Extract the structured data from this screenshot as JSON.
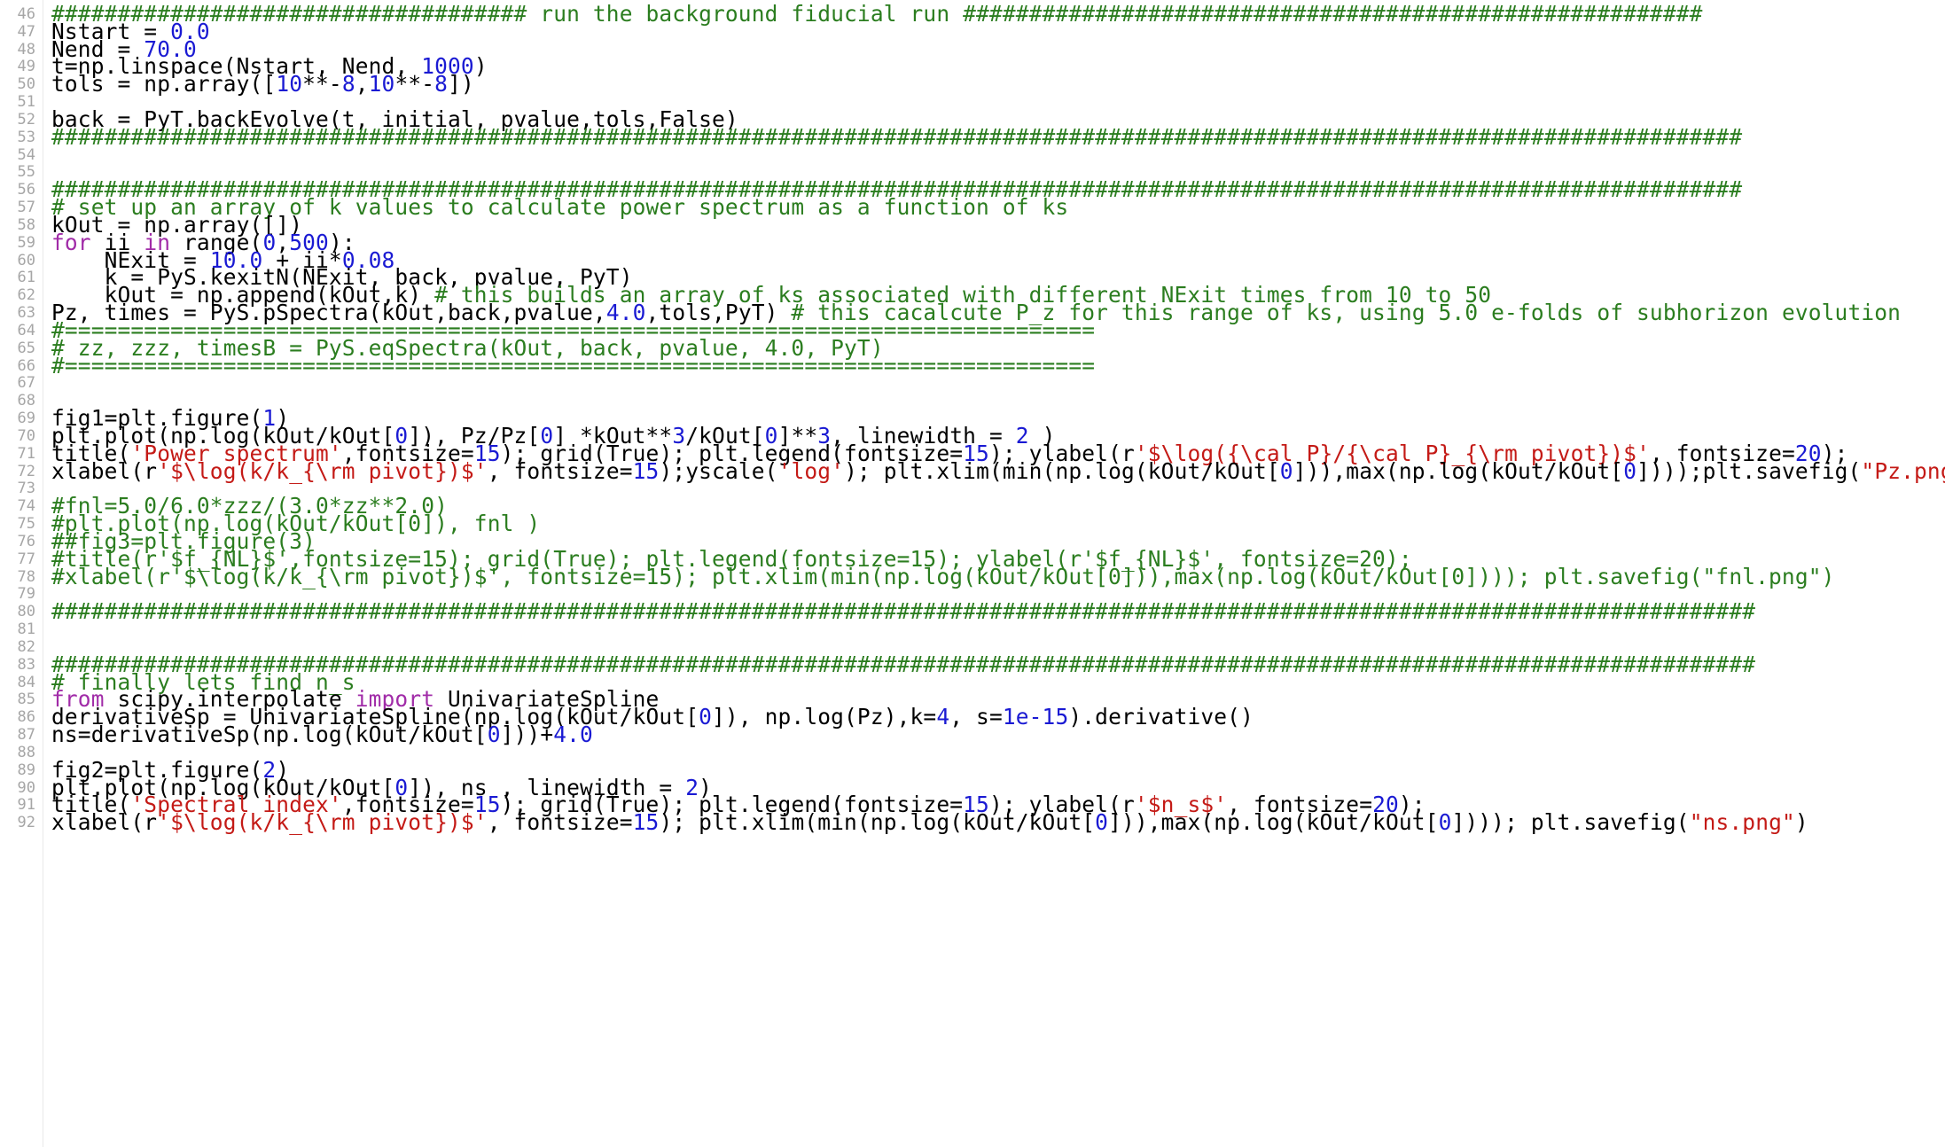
{
  "editor": {
    "colors": {
      "comment": "#2b7d1f",
      "keyword": "#a12ca8",
      "number": "#1a1ad3",
      "string": "#c41a16",
      "line_number": "#a6a6a6",
      "text": "#000000"
    },
    "lines": [
      {
        "n": "46",
        "t": "#################################### run the background fiducial run ########################################################"
      },
      {
        "n": "47",
        "t": "Nstart = 0.0"
      },
      {
        "n": "48",
        "t": "Nend = 70.0"
      },
      {
        "n": "49",
        "t": "t=np.linspace(Nstart, Nend, 1000)"
      },
      {
        "n": "50",
        "t": "tols = np.array([10**-8,10**-8])"
      },
      {
        "n": "51",
        "t": ""
      },
      {
        "n": "52",
        "t": "back = PyT.backEvolve(t, initial, pvalue,tols,False)"
      },
      {
        "n": "53",
        "t": "################################################################################################################################"
      },
      {
        "n": "54",
        "t": ""
      },
      {
        "n": "55",
        "t": ""
      },
      {
        "n": "56",
        "t": "################################################################################################################################"
      },
      {
        "n": "57",
        "t": "# set up an array of k values to calculate power spectrum as a function of ks"
      },
      {
        "n": "58",
        "t": "kOut = np.array([])"
      },
      {
        "n": "59",
        "t": "for ii in range(0,500):"
      },
      {
        "n": "60",
        "t": "    NExit = 10.0 + ii*0.08"
      },
      {
        "n": "61",
        "t": "    k = PyS.kexitN(NExit, back, pvalue, PyT)"
      },
      {
        "n": "62",
        "t": "    kOut = np.append(kOut,k) # this builds an array of ks associated with different NExit times from 10 to 50"
      },
      {
        "n": "63",
        "t": "Pz, times = PyS.pSpectra(kOut,back,pvalue,4.0,tols,PyT) # this cacalcute P_z for this range of ks, using 5.0 e-folds of subhorizon evolution"
      },
      {
        "n": "64",
        "t": "#=============================================================================="
      },
      {
        "n": "65",
        "t": "# zz, zzz, timesB = PyS.eqSpectra(kOut, back, pvalue, 4.0, PyT)"
      },
      {
        "n": "66",
        "t": "#=============================================================================="
      },
      {
        "n": "67",
        "t": ""
      },
      {
        "n": "68",
        "t": ""
      },
      {
        "n": "69",
        "t": "fig1=plt.figure(1)"
      },
      {
        "n": "70",
        "t": "plt.plot(np.log(kOut/kOut[0]), Pz/Pz[0] *kOut**3/kOut[0]**3, linewidth = 2 )"
      },
      {
        "n": "71",
        "t": "title('Power spectrum',fontsize=15); grid(True); plt.legend(fontsize=15); ylabel(r'$\\log({\\cal P}/{\\cal P}_{\\rm pivot})$', fontsize=20);"
      },
      {
        "n": "72",
        "t": "xlabel(r'$\\log(k/k_{\\rm pivot})$', fontsize=15);yscale('log'); plt.xlim(min(np.log(kOut/kOut[0])),max(np.log(kOut/kOut[0])));plt.savefig(\"Pz.png\")"
      },
      {
        "n": "73",
        "t": ""
      },
      {
        "n": "74",
        "t": "#fnl=5.0/6.0*zzz/(3.0*zz**2.0)"
      },
      {
        "n": "75",
        "t": "#plt.plot(np.log(kOut/kOut[0]), fnl )"
      },
      {
        "n": "76",
        "t": "##fig3=plt.figure(3)"
      },
      {
        "n": "77",
        "t": "#title(r'$f_{NL}$',fontsize=15); grid(True); plt.legend(fontsize=15); ylabel(r'$f_{NL}$', fontsize=20);"
      },
      {
        "n": "78",
        "t": "#xlabel(r'$\\log(k/k_{\\rm pivot})$', fontsize=15); plt.xlim(min(np.log(kOut/kOut[0])),max(np.log(kOut/kOut[0]))); plt.savefig(\"fnl.png\")"
      },
      {
        "n": "79",
        "t": ""
      },
      {
        "n": "80",
        "t": "#################################################################################################################################"
      },
      {
        "n": "81",
        "t": ""
      },
      {
        "n": "82",
        "t": ""
      },
      {
        "n": "83",
        "t": "#################################################################################################################################"
      },
      {
        "n": "84",
        "t": "# finally lets find n_s"
      },
      {
        "n": "85",
        "t": "from scipy.interpolate import UnivariateSpline"
      },
      {
        "n": "86",
        "t": "derivativeSp = UnivariateSpline(np.log(kOut/kOut[0]), np.log(Pz),k=4, s=1e-15).derivative()"
      },
      {
        "n": "87",
        "t": "ns=derivativeSp(np.log(kOut/kOut[0]))+4.0"
      },
      {
        "n": "88",
        "t": ""
      },
      {
        "n": "89",
        "t": "fig2=plt.figure(2)"
      },
      {
        "n": "90",
        "t": "plt.plot(np.log(kOut/kOut[0]), ns , linewidth = 2)"
      },
      {
        "n": "91",
        "t": "title('Spectral index',fontsize=15); grid(True); plt.legend(fontsize=15); ylabel(r'$n_s$', fontsize=20);"
      },
      {
        "n": "92",
        "t": "xlabel(r'$\\log(k/k_{\\rm pivot})$', fontsize=15); plt.xlim(min(np.log(kOut/kOut[0])),max(np.log(kOut/kOut[0]))); plt.savefig(\"ns.png\")"
      }
    ]
  }
}
